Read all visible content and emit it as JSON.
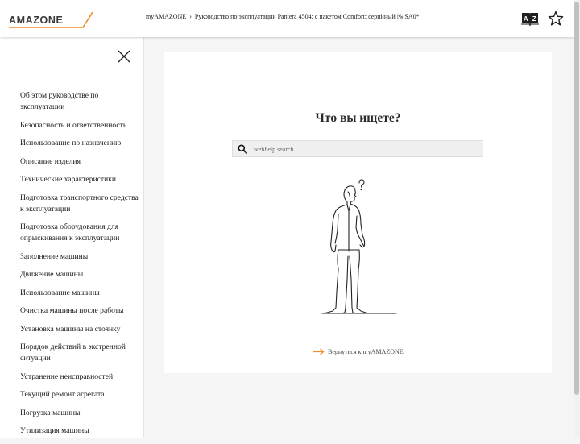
{
  "header": {
    "logo": "AMAZONE",
    "breadcrumb": {
      "home": "myAMAZONE",
      "separator": "›",
      "current": "Руководство по эксплуатации Pantera 4504; с пакетом Comfort; серийный № SA0*"
    },
    "icons": {
      "dictionary": "dictionary-az-icon",
      "favorite": "star-icon"
    }
  },
  "sidebar": {
    "close_icon": "close-icon",
    "items": [
      {
        "label": "Об этом руководстве по эксплуатации"
      },
      {
        "label": "Безопасность и ответственность"
      },
      {
        "label": "Использование по назначению"
      },
      {
        "label": "Описание изделия"
      },
      {
        "label": "Технические характеристики"
      },
      {
        "label": "Подготовка транспортного средства к эксплуатации"
      },
      {
        "label": "Подготовка оборудования для опрыскивания к эксплуатации"
      },
      {
        "label": "Заполнение машины"
      },
      {
        "label": "Движение машины"
      },
      {
        "label": "Использование машины"
      },
      {
        "label": "Очистка машины после работы"
      },
      {
        "label": "Установка машины на стоянку"
      },
      {
        "label": "Порядок действий в экстренной ситуации"
      },
      {
        "label": "Устранение неисправностей"
      },
      {
        "label": "Текущий ремонт агрегата"
      },
      {
        "label": "Погрузка машины"
      },
      {
        "label": "Утилизация машины"
      }
    ]
  },
  "main": {
    "title": "Что вы ищете?",
    "search": {
      "placeholder": "webhelp.search",
      "value": ""
    },
    "back_link": "Вернуться к myAMAZONE"
  },
  "colors": {
    "accent": "#f08a24",
    "background": "#f5f5f5",
    "card": "#ffffff",
    "text": "#222222"
  }
}
